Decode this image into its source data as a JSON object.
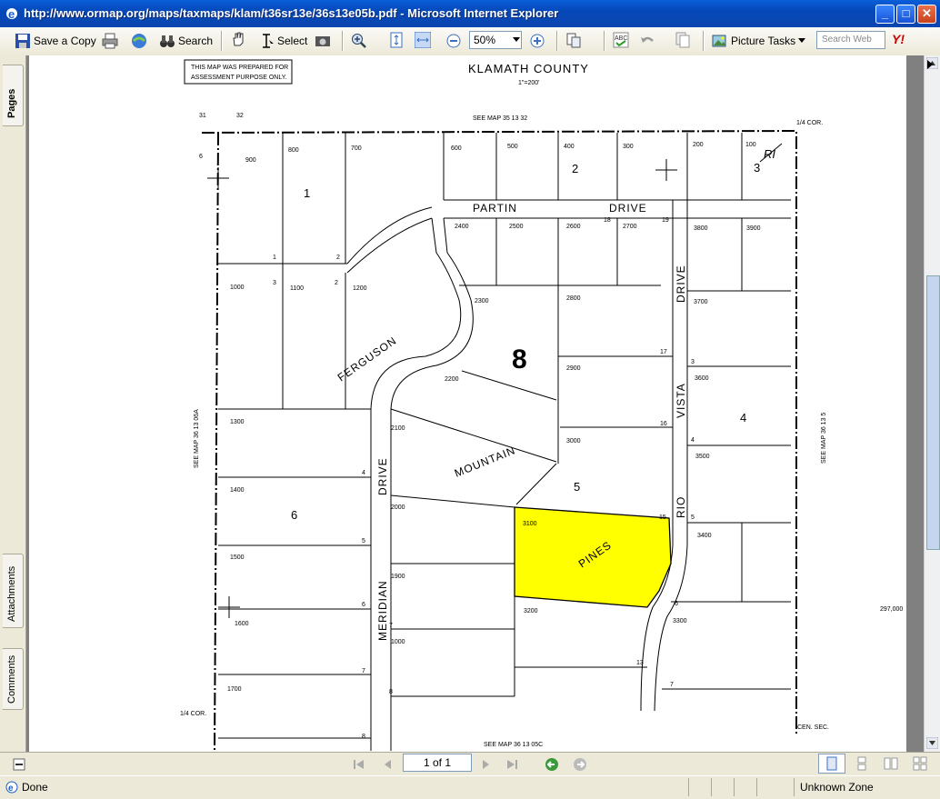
{
  "window": {
    "title": "http://www.ormap.org/maps/taxmaps/klam/t36sr13e/36s13e05b.pdf - Microsoft Internet Explorer",
    "minimize": "_",
    "maximize": "□",
    "close": "✕"
  },
  "toolbar": {
    "save_copy": "Save a Copy",
    "search": "Search",
    "select": "Select",
    "zoom": "50%",
    "picture_tasks": "Picture Tasks",
    "search_web_placeholder": "Search Web",
    "yahoo": "Y!"
  },
  "sidebar": {
    "pages": "Pages",
    "attachments": "Attachments",
    "comments": "Comments"
  },
  "map": {
    "notice_line1": "THIS MAP WAS PREPARED FOR",
    "notice_line2": "ASSESSMENT PURPOSE ONLY.",
    "county": "KLAMATH COUNTY",
    "scale": "1\"=200'",
    "see_map_top": "SEE MAP 35 13 32",
    "see_map_left": "SEE MAP 36 13 06A",
    "see_map_right": "SEE MAP 36 13 5",
    "see_map_bottom": "SEE MAP 36 13 05C",
    "corner_tr": "1/4 COR.",
    "corner_bl": "1/4 COR.",
    "sec_31": "31",
    "sec_32": "32",
    "sec_6": "6",
    "cen_sec": "CEN. SEC.",
    "coord_right": "297,000",
    "block_8": "8",
    "ri": "RI",
    "streets": {
      "partin": "PARTIN",
      "drive_top": "DRIVE",
      "ferguson": "FERGUSON",
      "mountain": "MOUNTAIN",
      "meridian": "MERIDIAN",
      "drive_left": "DRIVE",
      "vista": "VISTA",
      "drive_right": "DRIVE",
      "rio": "RIO",
      "pines": "PINES"
    },
    "blocks": {
      "b1": "1",
      "b2": "2",
      "b3": "3",
      "b4": "4",
      "b5": "5",
      "b6": "6"
    },
    "lots": {
      "l900": "900",
      "l800": "800",
      "l700": "700",
      "l600": "600",
      "l500": "500",
      "l400": "400",
      "l300": "300",
      "l200": "200",
      "l100": "100",
      "l1000": "1000",
      "l1100": "1100",
      "l1200": "1200",
      "l2400": "2400",
      "l2500": "2500",
      "l2600": "2600",
      "l2700": "2700",
      "l3800": "3800",
      "l3900": "3900",
      "l2300": "2300",
      "l2800": "2800",
      "l3700": "3700",
      "l2200": "2200",
      "l2900": "2900",
      "l3600": "3600",
      "l1300": "1300",
      "l2100": "2100",
      "l3000": "3000",
      "l3500": "3500",
      "l1400": "1400",
      "l2000": "2000",
      "l3100": "3100",
      "l3400": "3400",
      "l1500": "1500",
      "l1900": "1900",
      "l1600": "1600",
      "l3200": "3200",
      "l3300": "3300",
      "l1000b": "1000",
      "l1700": "1700"
    },
    "small_nums": {
      "n1a": "1",
      "n2a": "2",
      "n3a": "3",
      "n2b": "2",
      "n4a": "4",
      "n5a": "5",
      "n6a": "6",
      "n7a": "7",
      "n8a": "8",
      "n7b": "7",
      "n8b": "8",
      "n17": "17",
      "n16": "16",
      "n15": "15",
      "n13": "13",
      "n19": "19",
      "n18": "18",
      "n3b": "3",
      "n4b": "4",
      "n5b": "5",
      "n6b": "6",
      "n7c": "7"
    }
  },
  "navigation": {
    "page_indicator": "1 of 1"
  },
  "status": {
    "left": "Done",
    "zone": "Unknown Zone"
  },
  "colors": {
    "highlight": "#ffff00",
    "titlebar": "#0548b8"
  }
}
